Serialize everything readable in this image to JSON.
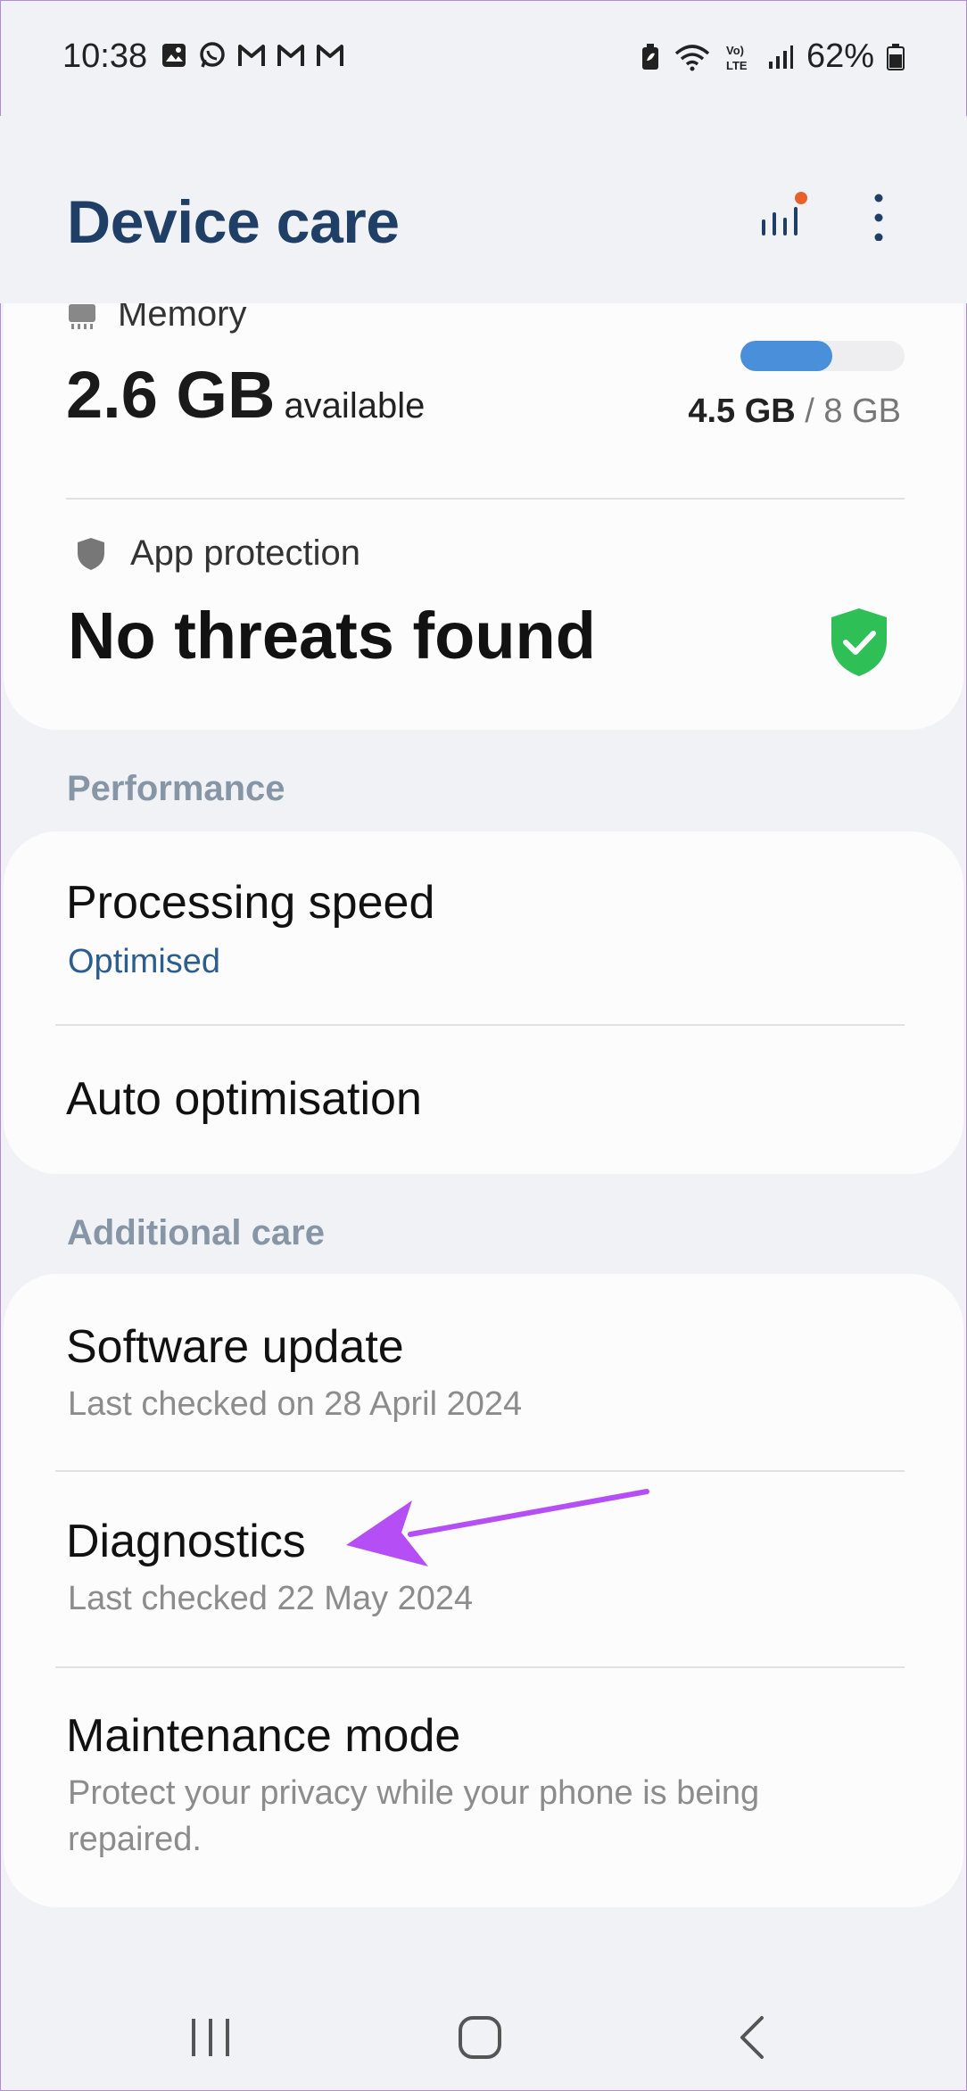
{
  "status_bar": {
    "time": "10:38",
    "battery": "62%"
  },
  "header": {
    "title": "Device care"
  },
  "memory": {
    "label": "Memory",
    "available_value": "2.6 GB",
    "available_unit": "available",
    "used": "4.5 GB",
    "separator": "/",
    "total": "8 GB",
    "used_fraction": 0.56
  },
  "app_protection": {
    "label": "App protection",
    "status": "No threats found"
  },
  "performance": {
    "section_label": "Performance",
    "items": [
      {
        "title": "Processing speed",
        "subtitle": "Optimised"
      },
      {
        "title": "Auto optimisation"
      }
    ]
  },
  "additional_care": {
    "section_label": "Additional care",
    "items": [
      {
        "title": "Software update",
        "subtitle": "Last checked on 28 April 2024"
      },
      {
        "title": "Diagnostics",
        "subtitle": "Last checked 22 May 2024"
      },
      {
        "title": "Maintenance mode",
        "subtitle": "Protect your privacy while your phone is being repaired."
      }
    ]
  },
  "colors": {
    "title": "#1f3f66",
    "accent": "#2c5d8f",
    "memory_bar": "#4a8fd9",
    "shield_ok": "#2fbf57",
    "notification_dot": "#e8602c",
    "annotation_arrow": "#b54ef5"
  },
  "icons": {
    "status_left": [
      "gallery-icon",
      "whatsapp-icon",
      "gmail-icon",
      "gmail-icon",
      "gmail-icon"
    ],
    "status_right": [
      "battery-saver-icon",
      "wifi-icon",
      "volte-icon",
      "signal-icon",
      "battery-icon"
    ],
    "header": [
      "stats-icon",
      "more-options-icon"
    ],
    "nav": [
      "recents-icon",
      "home-icon",
      "back-icon"
    ]
  }
}
